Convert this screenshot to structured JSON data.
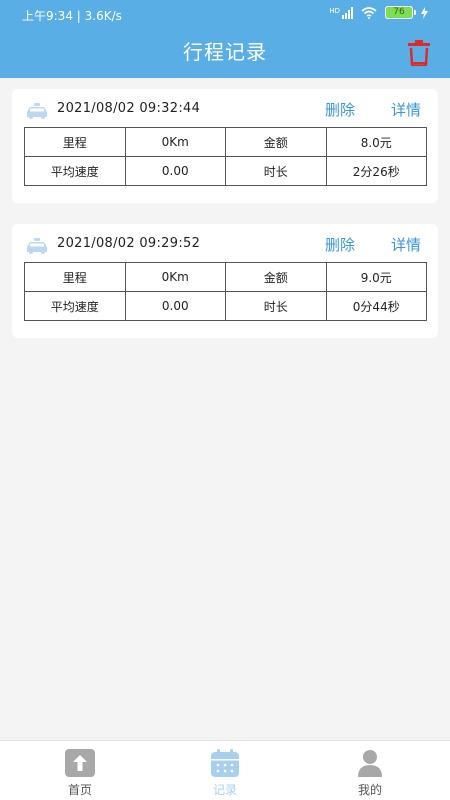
{
  "status_bar": {
    "time": "上午9:34",
    "speed": "3.6K/s",
    "network": "HD",
    "battery": "76"
  },
  "header": {
    "title": "行程记录",
    "trash_icon": "trash-icon"
  },
  "trips": [
    {
      "datetime": "2021/08/02  09:32:44",
      "delete_label": "删除",
      "detail_label": "详情",
      "mileage_label": "里程",
      "mileage": "0Km",
      "amount_label": "金额",
      "amount": "8.0元",
      "speed_label": "平均速度",
      "speed": "0.00",
      "duration_label": "时长",
      "duration": "2分26秒"
    },
    {
      "datetime": "2021/08/02  09:29:52",
      "delete_label": "删除",
      "detail_label": "详情",
      "mileage_label": "里程",
      "mileage": "0Km",
      "amount_label": "金额",
      "amount": "9.0元",
      "speed_label": "平均速度",
      "speed": "0.00",
      "duration_label": "时长",
      "duration": "0分44秒"
    }
  ],
  "bottom_nav": [
    {
      "label": "首页",
      "icon": "upload-arrow-icon"
    },
    {
      "label": "记录",
      "icon": "calendar-icon",
      "active": true
    },
    {
      "label": "我的",
      "icon": "user-icon"
    }
  ],
  "colors": {
    "header": "#5aaee6",
    "accent": "#3a96d8",
    "trash": "#e02a2a",
    "active_tab": "#a9cfee"
  }
}
